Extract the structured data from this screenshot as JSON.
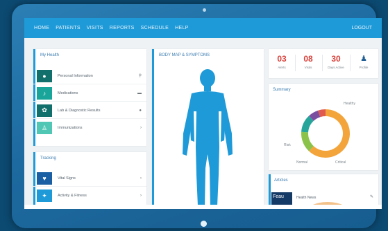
{
  "navbar": {
    "items": [
      "HOME",
      "PATIENTS",
      "VISITS",
      "REPORTS",
      "SCHEDULE",
      "HELP"
    ],
    "right_label": "LOGOUT"
  },
  "left_panel": {
    "title": "My Health",
    "rows": [
      {
        "label": "Personal Information",
        "tile_color": "#11706b",
        "icon": "stethoscope-icon"
      },
      {
        "label": "Medications",
        "tile_color": "#1aa59a",
        "icon": "pill-icon"
      },
      {
        "label": "Lab & Diagnostic Results",
        "tile_color": "#11706b",
        "icon": "flask-icon"
      },
      {
        "label": "Immunizations",
        "tile_color": "#4fc7b4",
        "icon": "syringe-icon"
      }
    ]
  },
  "left_panel2": {
    "title": "Tracking",
    "rows": [
      {
        "label": "Vital Signs",
        "tile_color": "#1a5fa3",
        "icon": "heart-icon"
      },
      {
        "label": "Activity & Fitness",
        "tile_color": "#1f9ad8",
        "icon": "run-icon"
      }
    ]
  },
  "body_panel": {
    "title": "BODY MAP & SYMPTOMS"
  },
  "stats": [
    {
      "value": "03",
      "label": "Alerts"
    },
    {
      "value": "08",
      "label": "Visits"
    },
    {
      "value": "30",
      "label": "Days Active"
    },
    {
      "value": "",
      "label": "Profile"
    }
  ],
  "chart_panel": {
    "title": "Summary",
    "label_top": "Healthy",
    "label_left": "Risk",
    "label_bottom_left": "Normal",
    "label_bottom_right": "Critical"
  },
  "chart_data": {
    "type": "pie",
    "donut": true,
    "slices": [
      {
        "value": 62,
        "color": "#f3a43b"
      },
      {
        "value": 14,
        "color": "#8bc34a"
      },
      {
        "value": 12,
        "color": "#26a69a"
      },
      {
        "value": 7,
        "color": "#7b4fa0"
      },
      {
        "value": 5,
        "color": "#e05a4f"
      }
    ]
  },
  "news_panel": {
    "title": "Articles",
    "item_label": "Health News",
    "thumb_text": "Feau"
  },
  "colors": {
    "nav": "#1f9ad8",
    "accent": "#1f9ad8",
    "body_figure": "#1f9ad8",
    "alert": "#d9403a"
  }
}
